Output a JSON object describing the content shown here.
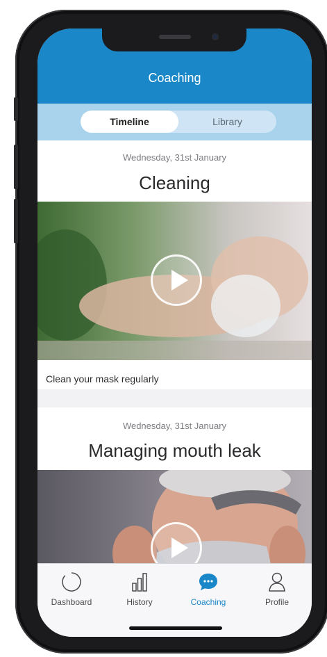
{
  "header": {
    "title": "Coaching"
  },
  "segmented": {
    "options": [
      "Timeline",
      "Library"
    ],
    "selected": "Timeline"
  },
  "feed": {
    "items": [
      {
        "date": "Wednesday, 31st January",
        "title": "Cleaning",
        "caption": "Clean your mask regularly",
        "media_icon": "play-icon"
      },
      {
        "date": "Wednesday, 31st January",
        "title": "Managing mouth leak",
        "media_icon": "play-icon"
      }
    ]
  },
  "tabbar": {
    "items": [
      {
        "label": "Dashboard",
        "icon": "dashboard-ring-icon"
      },
      {
        "label": "History",
        "icon": "bar-chart-icon"
      },
      {
        "label": "Coaching",
        "icon": "chat-bubble-icon",
        "active": true
      },
      {
        "label": "Profile",
        "icon": "person-icon"
      }
    ]
  },
  "colors": {
    "accent": "#1a87c8",
    "segment_bar": "#a9d2ec",
    "active_tab": "#1a87c8"
  }
}
